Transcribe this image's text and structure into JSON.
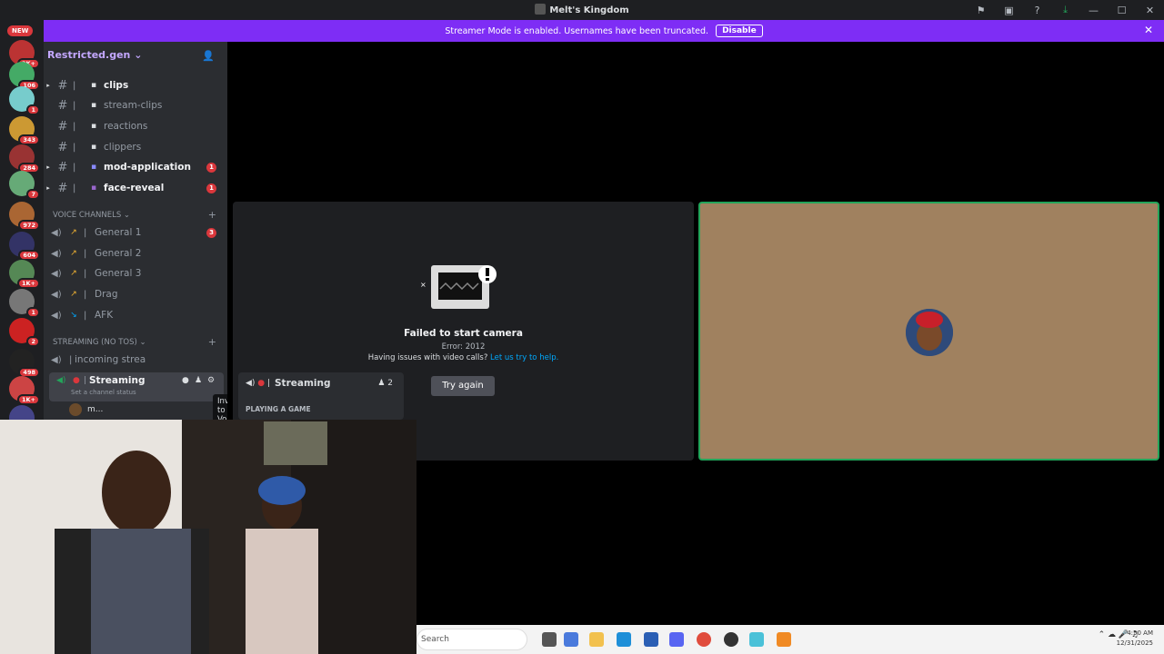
{
  "window": {
    "title": "Melt's Kingdom"
  },
  "banner": {
    "text": "Streamer Mode is enabled. Usernames have been truncated.",
    "disable_label": "Disable",
    "color": "#7e2df5"
  },
  "server_rail": {
    "new_label": "NEW",
    "badges": [
      "3K+",
      "106",
      "1",
      "343",
      "284",
      "7",
      "972",
      "604",
      "1K+",
      "1",
      "2",
      "498",
      "1K+"
    ]
  },
  "server": {
    "name": "Restricted.gen"
  },
  "text_channels": [
    {
      "name": "clips",
      "bold": true
    },
    {
      "name": "stream-clips",
      "bold": false
    },
    {
      "name": "reactions",
      "bold": false
    },
    {
      "name": "clippers",
      "bold": false
    },
    {
      "name": "mod-application",
      "bold": true,
      "unread": "1"
    },
    {
      "name": "face-reveal",
      "bold": true,
      "unread": "1"
    }
  ],
  "voice_category": {
    "label": "VOICE CHANNELS"
  },
  "voice_channels": [
    {
      "name": "General 1",
      "unread": "3"
    },
    {
      "name": "General 2"
    },
    {
      "name": "General 3"
    },
    {
      "name": "Drag"
    },
    {
      "name": "AFK"
    }
  ],
  "streaming_category": {
    "label": "STREAMING (NO TOS)"
  },
  "streaming_channels": {
    "incoming": "incoming strea",
    "active": "Streaming",
    "status_placeholder": "Set a channel status",
    "member": "m..."
  },
  "tooltip": {
    "text": "Invite to Voice"
  },
  "camera": {
    "title": "Failed to start camera",
    "error": "Error: 2012",
    "help_prefix": "Having issues with video calls?",
    "help_link": "Let us try to help.",
    "button": "Try again"
  },
  "voice_popup": {
    "channel": "Streaming",
    "count": "2",
    "activity": "PLAYING A GAME"
  },
  "taskbar": {
    "search_placeholder": "Search",
    "time": "4:50 AM",
    "date": "12/31/2025"
  }
}
